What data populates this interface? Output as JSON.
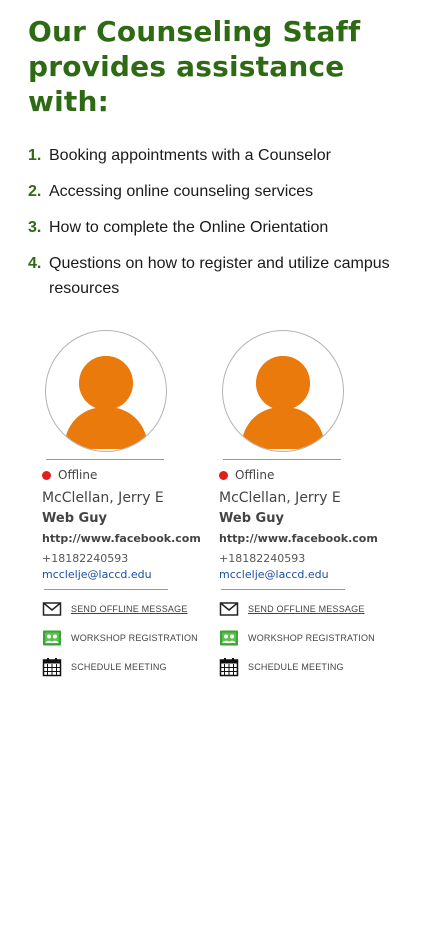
{
  "heading": "Our Counseling Staff provides assistance with:",
  "colors": {
    "heading_green": "#2e6a14",
    "avatar_orange": "#ea7a0c",
    "status_offline": "#e02020",
    "email_link": "#1c4ea0",
    "workshop_icon": "#3aa335"
  },
  "help_items": [
    {
      "num": "1.",
      "text": "Booking appointments with a Counselor"
    },
    {
      "num": "2.",
      "text": "Accessing online counseling services"
    },
    {
      "num": "3.",
      "text": "How to complete the Online Orientation"
    },
    {
      "num": "4.",
      "text": "Questions on how to register and utilize campus resources"
    }
  ],
  "staff": [
    {
      "status": "Offline",
      "name": "McClellan, Jerry E",
      "title": "Web Guy",
      "url": "http://www.facebook.com",
      "phone": "+18182240593",
      "email": "mcclelje@laccd.edu",
      "actions": {
        "message": {
          "label": "SEND OFFLINE MESSAGE",
          "icon": "envelope-icon"
        },
        "workshop": {
          "label": "WORKSHOP REGISTRATION",
          "icon": "workshop-icon"
        },
        "meeting": {
          "label": "SCHEDULE MEETING",
          "icon": "calendar-icon"
        }
      }
    },
    {
      "status": "Offline",
      "name": "McClellan, Jerry E",
      "title": "Web Guy",
      "url": "http://www.facebook.com",
      "phone": "+18182240593",
      "email": "mcclelje@laccd.edu",
      "actions": {
        "message": {
          "label": "SEND OFFLINE MESSAGE",
          "icon": "envelope-icon"
        },
        "workshop": {
          "label": "WORKSHOP REGISTRATION",
          "icon": "workshop-icon"
        },
        "meeting": {
          "label": "SCHEDULE MEETING",
          "icon": "calendar-icon"
        }
      }
    }
  ]
}
